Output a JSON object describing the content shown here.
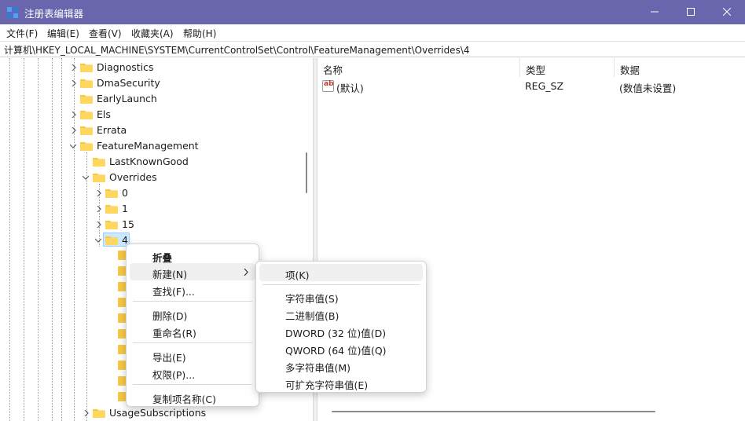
{
  "window": {
    "title": "注册表编辑器",
    "accent": "#6a66ad"
  },
  "menubar": {
    "items": [
      "文件(F)",
      "编辑(E)",
      "查看(V)",
      "收藏夹(A)",
      "帮助(H)"
    ]
  },
  "address": "计算机\\HKEY_LOCAL_MACHINE\\SYSTEM\\CurrentControlSet\\Control\\FeatureManagement\\Overrides\\4",
  "tree": {
    "items": [
      {
        "label": "Diagnostics",
        "expanded": false
      },
      {
        "label": "DmaSecurity",
        "expanded": false
      },
      {
        "label": "EarlyLaunch",
        "expanded": false
      },
      {
        "label": "Els",
        "expanded": false
      },
      {
        "label": "Errata",
        "expanded": false
      },
      {
        "label": "FeatureManagement",
        "expanded": true
      },
      {
        "label": "LastKnownGood",
        "expanded": false
      },
      {
        "label": "Overrides",
        "expanded": true
      },
      {
        "label": "0",
        "expanded": false
      },
      {
        "label": "1",
        "expanded": false
      },
      {
        "label": "15",
        "expanded": false
      },
      {
        "label": "4",
        "expanded": true,
        "selected": true
      },
      {
        "label": "UsageSubscriptions",
        "expanded": false
      }
    ]
  },
  "list": {
    "columns": [
      "名称",
      "类型",
      "数据"
    ],
    "rows": [
      {
        "name": "(默认)",
        "type": "REG_SZ",
        "data": "(数值未设置)",
        "icon": "string-value-icon"
      }
    ]
  },
  "context_menu": {
    "items": [
      {
        "label": "折叠",
        "bold": true
      },
      {
        "label": "新建(N)",
        "submenu": true,
        "hovered": true
      },
      {
        "label": "查找(F)..."
      },
      {
        "label": "删除(D)"
      },
      {
        "label": "重命名(R)"
      },
      {
        "label": "导出(E)"
      },
      {
        "label": "权限(P)..."
      },
      {
        "label": "复制项名称(C)"
      }
    ]
  },
  "submenu": {
    "items": [
      {
        "label": "项(K)",
        "hovered": true
      },
      {
        "label": "字符串值(S)"
      },
      {
        "label": "二进制值(B)"
      },
      {
        "label": "DWORD (32 位)值(D)"
      },
      {
        "label": "QWORD (64 位)值(Q)"
      },
      {
        "label": "多字符串值(M)"
      },
      {
        "label": "可扩充字符串值(E)"
      }
    ]
  }
}
